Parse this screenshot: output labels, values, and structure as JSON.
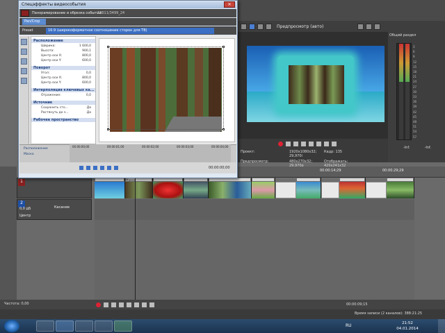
{
  "dialog": {
    "title": "Спецэффекты видеособытия",
    "fx_chain_label": "Панорамирование и обрезка событий:",
    "fx_event_id": "12011/3499_24",
    "fx_tab": "Pan/Crop",
    "preset_label": "Preset",
    "preset_value": "16:9 (широкоформатное соотношение сторон для ТВ)",
    "close": "✕"
  },
  "properties": {
    "sections": [
      {
        "title": "Расположение",
        "rows": [
          [
            "Ширина:",
            "1 600,0"
          ],
          [
            "Высота:",
            "900,1"
          ],
          [
            "Центр оси X:",
            "800,0"
          ],
          [
            "Центр оси Y:",
            "600,0"
          ]
        ]
      },
      {
        "title": "Поворот",
        "rows": [
          [
            "Угол:",
            "0,0"
          ],
          [
            "Центр оси X:",
            "800,0"
          ],
          [
            "Центр оси Y:",
            "600,0"
          ]
        ]
      },
      {
        "title": "Интерполяция ключевых ка...",
        "rows": [
          [
            "Отражение:",
            "0,0"
          ]
        ]
      },
      {
        "title": "Источник",
        "rows": [
          [
            "Сохранить сто...",
            "Да"
          ],
          [
            "Растянуть до з...",
            "Да"
          ]
        ]
      },
      {
        "title": "Рабочее пространство",
        "rows": []
      }
    ]
  },
  "keyframes": {
    "row1": "Расположение",
    "row2": "Маска",
    "ticks": [
      "00:00:00;00",
      "00:00:01;00",
      "00:00:02;00",
      "00:00:03;00",
      "00:00:04;00"
    ],
    "time": "00:00:00;00"
  },
  "preview": {
    "mode": "Предпросмотр (авто)",
    "info": [
      [
        "Проект:",
        "1920x1080x32; 29,970i",
        "Кадр:",
        "135"
      ],
      [
        "Предпросмотр:",
        "480x270x32; 29,970p",
        "Отображать:",
        "420x241x32"
      ]
    ]
  },
  "meter": {
    "title": "Общий раздел",
    "scale": [
      "3",
      "6",
      "9",
      "12",
      "15",
      "18",
      "21",
      "24",
      "27",
      "30",
      "33",
      "36",
      "39",
      "42",
      "45",
      "48",
      "51",
      "54",
      "57"
    ],
    "values": [
      "-Inf.",
      "-Inf."
    ]
  },
  "timeline": {
    "ruler_ticks": [
      "00:00:14;29",
      "00:00:29;29"
    ],
    "video_track_number": "1",
    "audio_track_number": "2",
    "audio_volume": "0,0 дБ",
    "audio_mode": "Касание",
    "audio_pan": "Центр",
    "clip_labels": [
      "Маска",
      "Мол.обсб.",
      "Смещ."
    ],
    "bottom_time": "00:00:09;15",
    "rate": "Частота: 0,00",
    "record_time": "Время записи (2 каналов): 388:21:25"
  },
  "taskbar": {
    "language": "RU",
    "time": "21:52",
    "date": "04.01.2014"
  }
}
